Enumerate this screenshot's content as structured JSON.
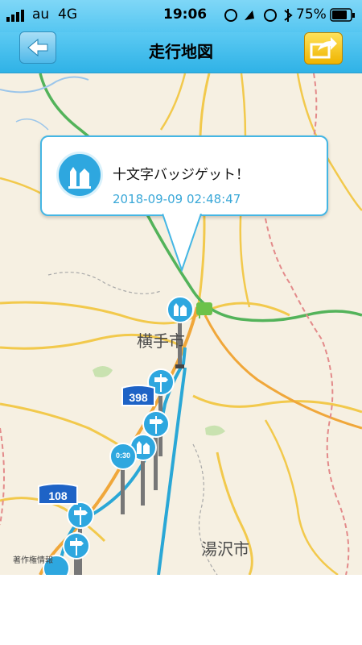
{
  "status": {
    "carrier": "au",
    "network": "4G",
    "time": "19:06",
    "battery": "75%"
  },
  "nav": {
    "title": "走行地図",
    "back_icon": "left-arrow-icon",
    "share_icon": "share-arrow-icon"
  },
  "popup": {
    "title": "十文字バッジゲット！",
    "timestamp": "2018-09-09 02:48:47",
    "badge_icon": "church-badge-icon"
  },
  "map": {
    "city_yokote": "横手市",
    "city_yuzawa": "湯沢市",
    "route_398": "398",
    "route_108": "108",
    "copyright": "著作権情報",
    "marker_text": "0:30",
    "colors": {
      "track": "#2aa7d6",
      "marker": "#2ea7df",
      "accent_green": "#6cc24a"
    }
  }
}
